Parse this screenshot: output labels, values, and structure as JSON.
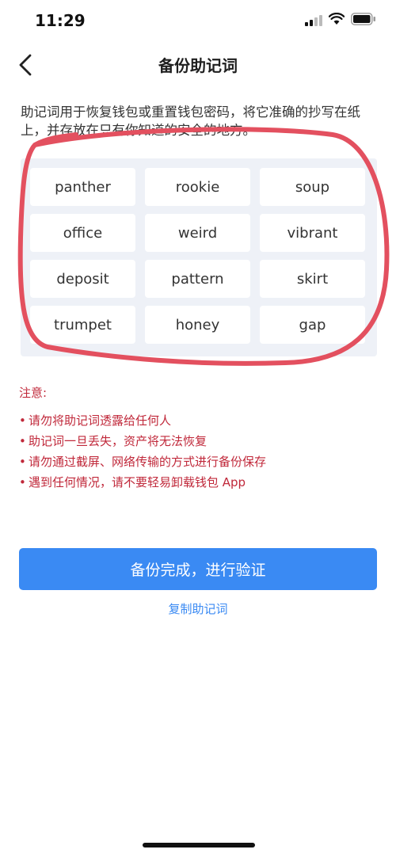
{
  "status_bar": {
    "time": "11:29"
  },
  "header": {
    "title": "备份助记词"
  },
  "description": "助记词用于恢复钱包或重置钱包密码，将它准确的抄写在纸上，并存放在只有你知道的安全的地方。",
  "mnemonic": {
    "words": [
      "panther",
      "rookie",
      "soup",
      "office",
      "weird",
      "vibrant",
      "deposit",
      "pattern",
      "skirt",
      "trumpet",
      "honey",
      "gap"
    ]
  },
  "notice": {
    "title": "注意:",
    "items": [
      "请勿将助记词透露给任何人",
      "助记词一旦丢失，资产将无法恢复",
      "请勿通过截屏、网络传输的方式进行备份保存",
      "遇到任何情况，请不要轻易卸载钱包 App"
    ]
  },
  "actions": {
    "primary_label": "备份完成，进行验证",
    "copy_label": "复制助记词"
  },
  "colors": {
    "accent": "#3a8af3",
    "warning": "#c0283a",
    "annotation": "#e3505f"
  }
}
